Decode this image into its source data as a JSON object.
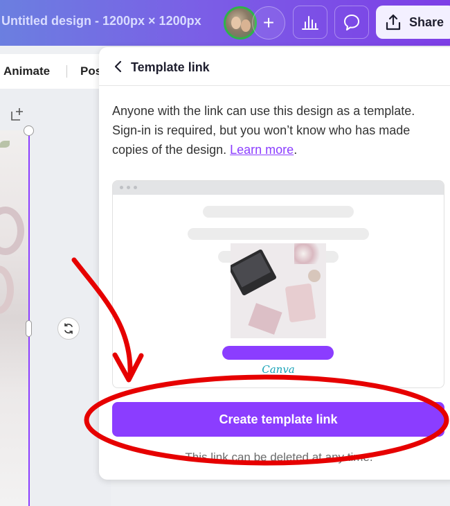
{
  "header": {
    "doc_title": "Untitled design - 1200px × 1200px",
    "share_label": "Share",
    "add_label": "+"
  },
  "toolbar": {
    "animate_label": "Animate",
    "position_label": "Pos"
  },
  "panel": {
    "title": "Template link",
    "description": "Anyone with the link can use this design as a template. Sign-in is required, but you won’t know who has made copies of the design.",
    "learn_more": "Learn more",
    "description_end": ".",
    "preview_logo": "Canva",
    "create_button": "Create template link",
    "footnote": "This link can be deleted at any time."
  },
  "colors": {
    "accent": "#8b3dff",
    "annotation": "#e60000"
  },
  "icons": [
    "chevron-left-icon",
    "share-upload-icon",
    "insights-icon",
    "comment-icon",
    "add-page-icon",
    "rotate-icon"
  ]
}
